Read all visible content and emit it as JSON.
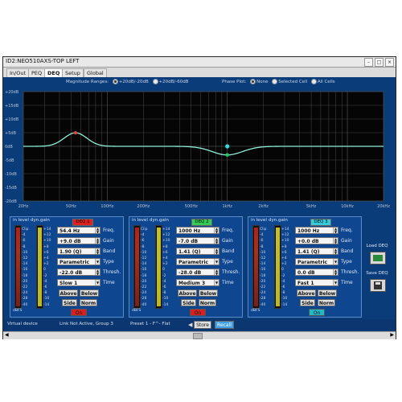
{
  "window": {
    "title": "ID2:NEO510AXS-TOP LEFT"
  },
  "tabs": [
    {
      "label": "In/Out"
    },
    {
      "label": "PEQ"
    },
    {
      "label": "DEQ"
    },
    {
      "label": "Setup"
    },
    {
      "label": "Global"
    }
  ],
  "plot": {
    "magnitude_label": "Magnitude Ranges:",
    "range_1": "+20dB/-20dB",
    "range_2": "+20dB/-60dB",
    "phase_label": "Phase Plot:",
    "phase_none": "None",
    "phase_selected": "Selected Cell",
    "phase_all": "All Cells",
    "y_ticks": [
      "+20dB",
      "+15dB",
      "+10dB",
      "+5dB",
      "0dB",
      "-5dB",
      "-10dB",
      "-15dB",
      "-20dB"
    ],
    "x_ticks": [
      "20Hz",
      "50Hz",
      "100Hz",
      "200Hz",
      "500Hz",
      "1kHz",
      "2kHz",
      "5kHz",
      "10kHz",
      "20kHz"
    ],
    "curve_color": "#8ff0d8",
    "marker_colors": [
      "#e04040",
      "#22cc66",
      "#33dddd"
    ]
  },
  "meter_labels": {
    "in_level": "in level",
    "dyn_gain": "dyn.gain",
    "dbfs": "dBFS",
    "clip": "Clip"
  },
  "field_labels": {
    "freq": "Freq.",
    "gain": "Gain",
    "band": "Band",
    "type": "Type",
    "thresh": "Thresh.",
    "time": "Time"
  },
  "deq": [
    {
      "badge": "DEQ 1",
      "badge_color": "#e02020",
      "freq": "54.4 Hz",
      "gain": "+9.0 dB",
      "band": "1.90 (Q)",
      "type": "Parametric",
      "thresh": "-22.0 dB",
      "time": "Slow 1",
      "above": "Above",
      "below": "Below",
      "side": "Side",
      "norm": "Norm",
      "on_label": "On",
      "on_color": "#d82020"
    },
    {
      "badge": "DEQ 2",
      "badge_color": "#33cc55",
      "freq": "1000 Hz",
      "gain": "-7.0 dB",
      "band": "1.41 (Q)",
      "type": "Parametric",
      "thresh": "-28.0 dB",
      "time": "Medium 3",
      "above": "Above",
      "below": "Below",
      "side": "Side",
      "norm": "Norm",
      "on_label": "On",
      "on_color": "#d82020"
    },
    {
      "badge": "DEQ 3",
      "badge_color": "#33ccdd",
      "freq": "1000 Hz",
      "gain": "+0.0 dB",
      "band": "1.41 (Q)",
      "type": "Parametric",
      "thresh": "0.0 dB",
      "time": "Fast 1",
      "above": "Above",
      "below": "Below",
      "side": "Side",
      "norm": "Norm",
      "on_label": "On",
      "on_color": "#22b8c8"
    }
  ],
  "side_actions": {
    "load": "Load DEQ",
    "save": "Save DEQ"
  },
  "status": {
    "device": "Virtual device",
    "link": "Link Not Active,  Group 3",
    "preset": "Preset   1 - F^- Flat",
    "store": "Store",
    "recall": "Recall"
  }
}
